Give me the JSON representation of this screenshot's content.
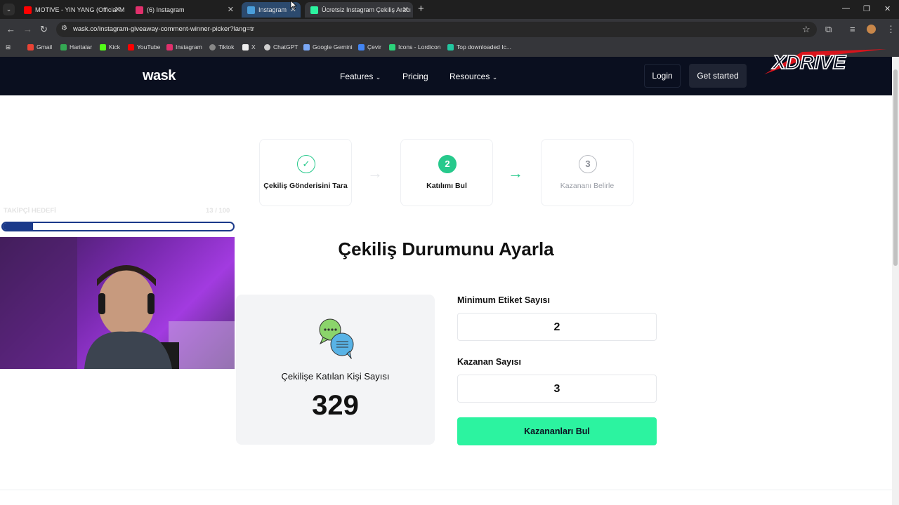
{
  "browser": {
    "tabs": [
      {
        "title": "MOTIVE - YIN YANG (Official M",
        "color": "#ff0000"
      },
      {
        "title": "(6) Instagram",
        "color": "#e1306c"
      },
      {
        "title": "Instagram",
        "color": "#4a9eda"
      },
      {
        "title": "Ücretsiz Instagram Çekiliş Aracı",
        "color": "#2cf3a0"
      }
    ],
    "url": "wask.co/instagram-giveaway-comment-winner-picker?lang=tr",
    "bookmarks": [
      "Gmail",
      "Haritalar",
      "Kick",
      "YouTube",
      "Instagram",
      "Tiktok",
      "X",
      "ChatGPT",
      "Google Gemini",
      "Çevir",
      "Icons - Lordicon",
      "Top downloaded Ic..."
    ]
  },
  "site": {
    "logo": "wask",
    "nav": [
      "Features",
      "Pricing",
      "Resources"
    ],
    "login": "Login",
    "get_started": "Get started"
  },
  "overlay": {
    "brand": "XDRIVE",
    "follower_label": "TAKİPÇİ HEDEFİ",
    "follower_count": "13 / 100",
    "follower_progress": 0.13
  },
  "steps": [
    {
      "number": "✓",
      "label": "Çekiliş Gönderisini Tara",
      "state": "done"
    },
    {
      "number": "2",
      "label": "Katılımı Bul",
      "state": "active"
    },
    {
      "number": "3",
      "label": "Kazananı Belirle",
      "state": "pending"
    }
  ],
  "main": {
    "title": "Çekiliş Durumunu Ayarla",
    "participants_label": "Çekilişe Katılan Kişi Sayısı",
    "participants_value": "329",
    "min_tag_label": "Minimum Etiket Sayısı",
    "min_tag_value": "2",
    "winner_count_label": "Kazanan Sayısı",
    "winner_count_value": "3",
    "find_winners": "Kazananları Bul"
  },
  "colors": {
    "accent": "#2cf3a0",
    "step_active": "#27c98c",
    "header_bg": "#0a0f1f"
  }
}
